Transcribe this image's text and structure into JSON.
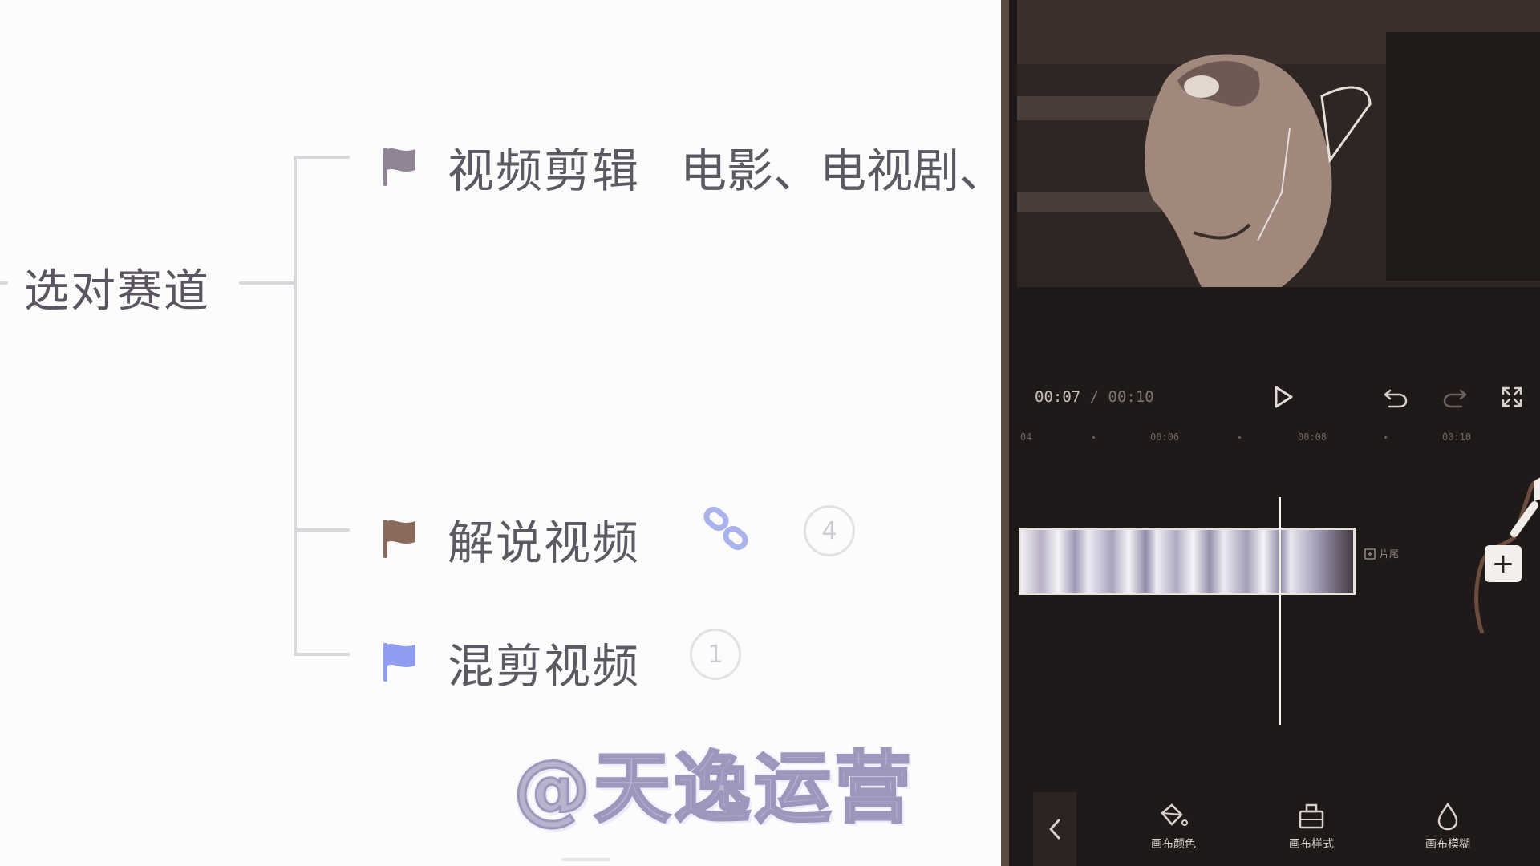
{
  "mindmap": {
    "root": "选对赛道",
    "nodes": [
      {
        "label": "视频剪辑",
        "desc": "电影、电视剧、",
        "flag_color": "#8f8595"
      },
      {
        "label": "解说视频",
        "badge": "4",
        "flag_color": "#8a6a5c"
      },
      {
        "label": "混剪视频",
        "badge": "1",
        "flag_color": "#8f9cf0"
      }
    ]
  },
  "watermark": "@天逸运营",
  "editor": {
    "time_current": "00:07",
    "time_separator": " / ",
    "time_total": "00:10",
    "ruler": [
      "04",
      "00:06",
      "00:08",
      "00:10"
    ],
    "clip_tag": "片尾",
    "tools": [
      {
        "label": "画布颜色",
        "icon": "paint-bucket-icon"
      },
      {
        "label": "画布样式",
        "icon": "canvas-style-icon"
      },
      {
        "label": "画布模糊",
        "icon": "blur-drop-icon"
      }
    ],
    "add_label": "+"
  },
  "colors": {
    "editor_bg": "#1f1a19",
    "accent_blue_flag": "#8f9cf0",
    "mindmap_text": "#5d5963"
  }
}
